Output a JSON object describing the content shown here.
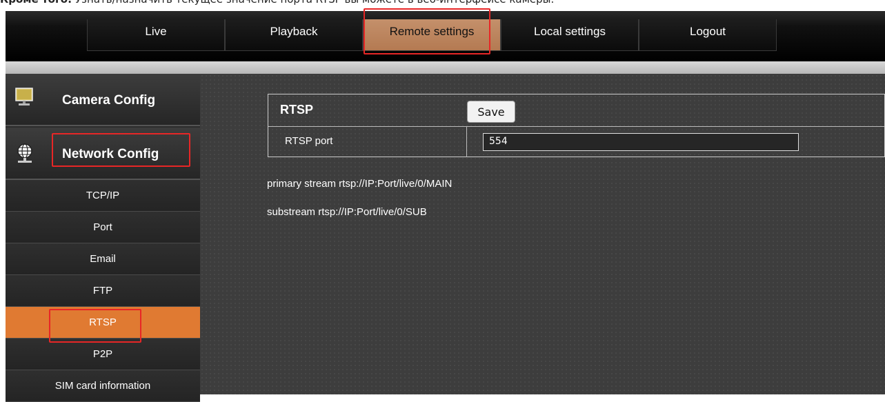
{
  "doc_caption": {
    "bold": "Кроме того:",
    "text": "Узнать/назначить текущее значение порта RTSP вы можете в веб-интерфейсе камеры."
  },
  "nav": {
    "items": [
      {
        "label": "Live"
      },
      {
        "label": "Playback"
      },
      {
        "label": "Remote settings",
        "active": true
      },
      {
        "label": "Local settings"
      },
      {
        "label": "Logout"
      }
    ]
  },
  "sidebar": {
    "camera_config": {
      "label": "Camera Config",
      "icon": "monitor-icon"
    },
    "network_config": {
      "label": "Network Config",
      "icon": "globe-network-icon"
    },
    "items": [
      {
        "label": "TCP/IP"
      },
      {
        "label": "Port"
      },
      {
        "label": "Email"
      },
      {
        "label": "FTP"
      },
      {
        "label": "RTSP",
        "active": true
      },
      {
        "label": "P2P"
      },
      {
        "label": "SIM card information"
      }
    ]
  },
  "rtsp": {
    "title": "RTSP",
    "save_label": "Save",
    "port_label": "RTSP port",
    "port_value": "554",
    "primary_stream": "primary stream rtsp://IP:Port/live/0/MAIN",
    "substream": "substream rtsp://IP:Port/live/0/SUB"
  },
  "colors": {
    "active_nav": "#c4906b",
    "active_sidebar": "#e07a32",
    "annotation": "#e82626"
  }
}
